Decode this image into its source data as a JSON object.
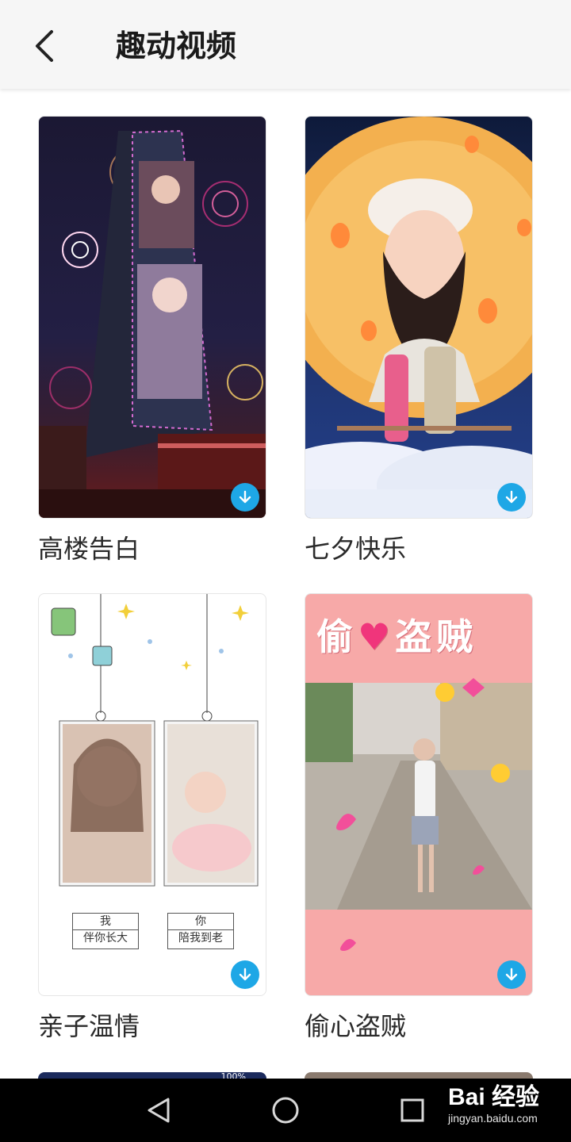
{
  "header": {
    "title": "趣动视频"
  },
  "cards": [
    {
      "label": "高楼告白"
    },
    {
      "label": "七夕快乐"
    },
    {
      "label": "亲子温情",
      "art": {
        "box1_top": "我",
        "box1_bottom": "伴你长大",
        "box2_top": "你",
        "box2_bottom": "陪我到老"
      }
    },
    {
      "label": "偷心盗贼",
      "art": {
        "title_left": "偷",
        "title_right": "盗贼",
        "heart": "♥"
      }
    }
  ],
  "peek": {
    "status_text": "100%"
  },
  "watermark": {
    "line1": "Bai 经验",
    "line2": "jingyan.baidu.com"
  },
  "colors": {
    "accent": "#1ea7e6",
    "topbar": "#f6f6f6",
    "pink": "#f7a9a8"
  },
  "icons": [
    "back-arrow-icon",
    "download-icon",
    "nav-back-icon",
    "nav-home-icon",
    "nav-recents-icon"
  ]
}
